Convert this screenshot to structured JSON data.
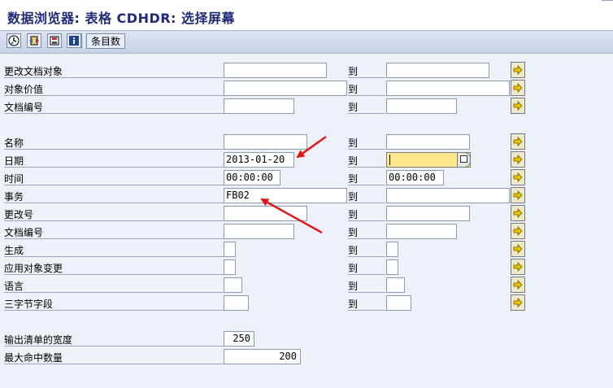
{
  "title": "数据浏览器: 表格 CDHDR: 选择屏幕",
  "toolbar": {
    "text_button": "条目数",
    "icons": [
      "execute-icon",
      "get-variant-icon",
      "save-variant-icon",
      "info-icon"
    ]
  },
  "to_label": "到",
  "fields": {
    "r1": {
      "label": "更改文档对象",
      "from": "",
      "to": ""
    },
    "r2": {
      "label": "对象价值",
      "from": "",
      "to": ""
    },
    "r3": {
      "label": "文档编号",
      "from": "",
      "to": ""
    },
    "r4": {
      "label": "名称",
      "from": "",
      "to": ""
    },
    "r5": {
      "label": "日期",
      "from": "2013-01-20",
      "to": ""
    },
    "r6": {
      "label": "时间",
      "from": "00:00:00",
      "to": "00:00:00"
    },
    "r7": {
      "label": "事务",
      "from": "FB02",
      "to": ""
    },
    "r8": {
      "label": "更改号",
      "from": "",
      "to": ""
    },
    "r9": {
      "label": "文档编号",
      "from": "",
      "to": ""
    },
    "r10": {
      "label": "生成",
      "from": "",
      "to": ""
    },
    "r11": {
      "label": "应用对象变更",
      "from": "",
      "to": ""
    },
    "r12": {
      "label": "语言",
      "from": "",
      "to": ""
    },
    "r13": {
      "label": "三字节字段",
      "from": "",
      "to": ""
    }
  },
  "output": {
    "width_label": "输出清单的宽度",
    "width_value": "250",
    "max_hits_label": "最大命中数量",
    "max_hits_value": "200"
  },
  "colors": {
    "title": "#1f2a78",
    "active_field": "#fde98c",
    "annotation_arrow": "#e01818",
    "multiple_selection_arrow": "#f0c000"
  }
}
